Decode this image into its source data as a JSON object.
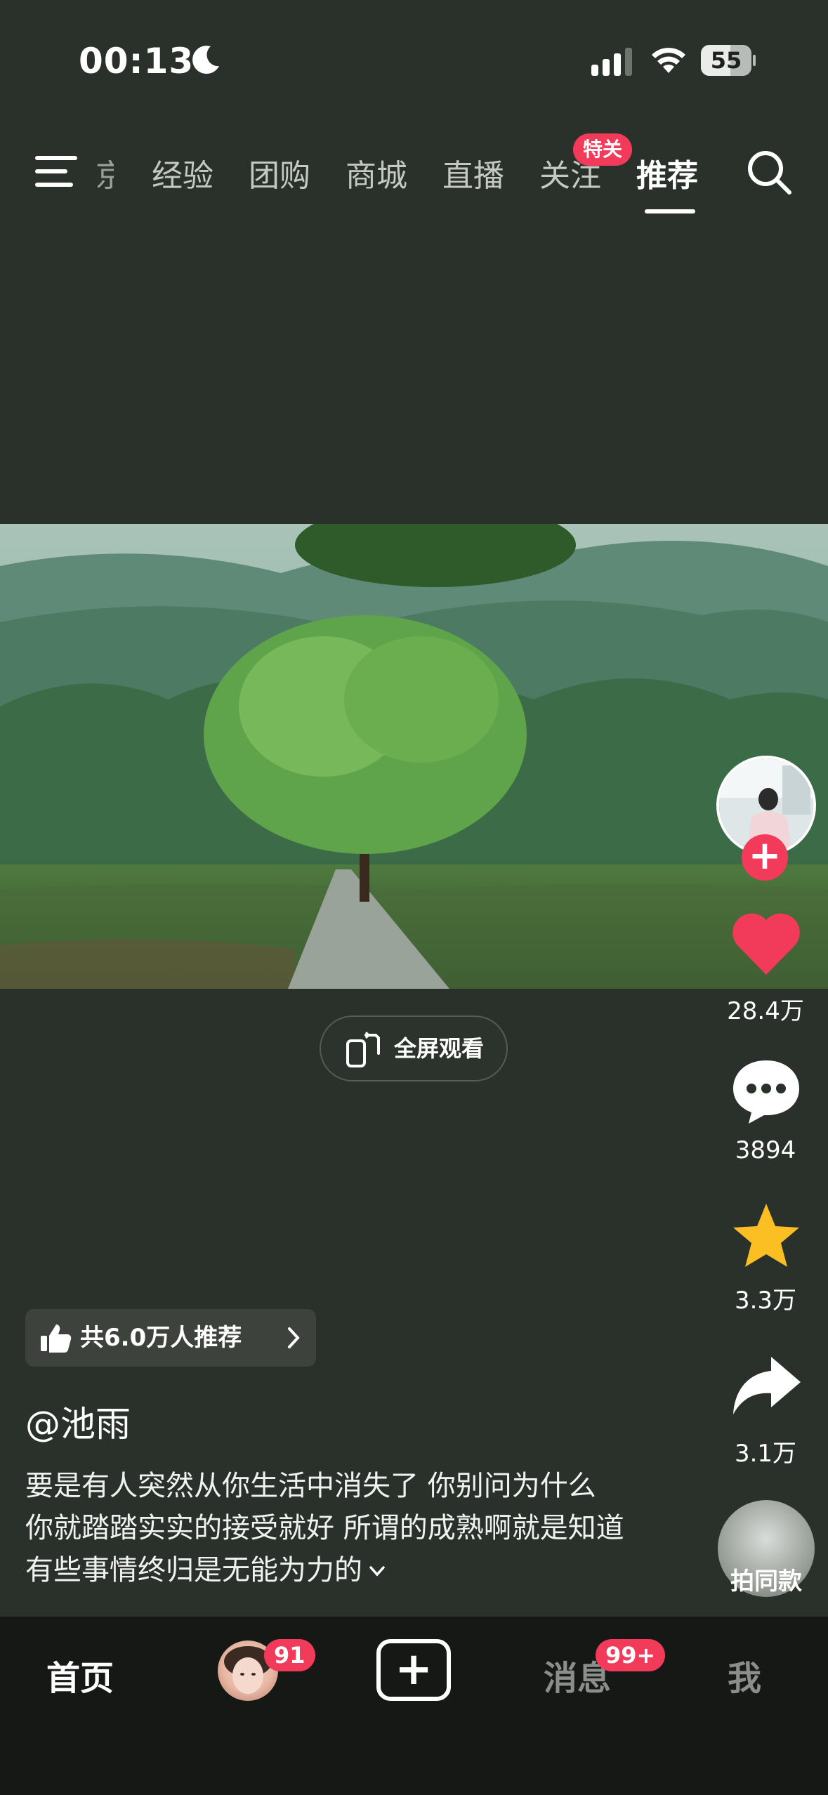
{
  "status_bar": {
    "time": "00:13",
    "battery": "55"
  },
  "nav": {
    "partial_tab": "京",
    "tabs": [
      "经验",
      "团购",
      "商城",
      "直播",
      "关注",
      "推荐"
    ],
    "follow_badge": "特关"
  },
  "video": {
    "fullscreen_label": "全屏观看"
  },
  "actions": {
    "likes": "28.4万",
    "comments": "3894",
    "favorites": "3.3万",
    "shares": "3.1万",
    "same_style": "拍同款"
  },
  "post": {
    "recommend_label": "共6.0万人推荐",
    "author": "@池雨",
    "caption": "要是有人突然从你生活中消失了 你别问为什么 你就踏踏实实的接受就好 所谓的成熟啊就是知道有些事情终归是无能为力的"
  },
  "tabbar": {
    "home": "首页",
    "friends_badge": "91",
    "messages": "消息",
    "messages_badge": "99+",
    "me": "我"
  },
  "colors": {
    "accent": "#f23a5a",
    "background": "#2a302a",
    "star": "#fbbf24"
  }
}
